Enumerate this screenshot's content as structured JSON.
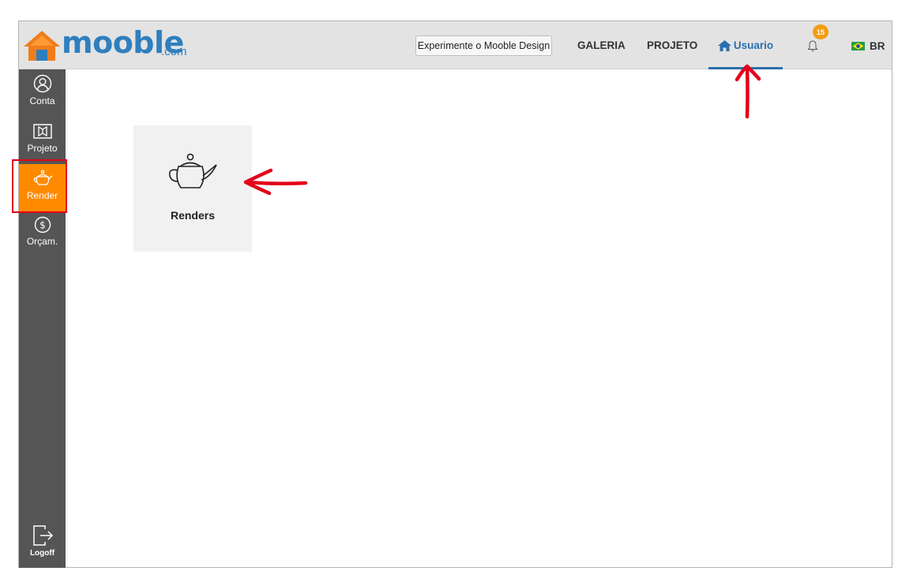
{
  "header": {
    "logo_text": "mooble",
    "logo_suffix": ".com",
    "try_button_label": "Experimente o Mooble Design",
    "nav": [
      {
        "label": "GALERIA"
      },
      {
        "label": "PROJETO"
      },
      {
        "label": "Usuario",
        "active": true
      }
    ],
    "notification_count": "15",
    "language_label": "BR"
  },
  "sidebar": {
    "items": [
      {
        "label": "Conta",
        "icon": "user-icon"
      },
      {
        "label": "Projeto",
        "icon": "project-icon"
      },
      {
        "label": "Render",
        "icon": "teapot-icon",
        "active": true
      },
      {
        "label": "Orçam.",
        "icon": "dollar-icon"
      }
    ],
    "logoff_label": "Logoff"
  },
  "main": {
    "tile": {
      "label": "Renders",
      "icon": "teapot-icon"
    }
  },
  "colors": {
    "accent_orange": "#ff8a00",
    "brand_blue": "#2f7fbe",
    "active_nav_blue": "#2a6fad",
    "sidebar_bg": "#555555",
    "annotation_red": "#e3001b"
  }
}
